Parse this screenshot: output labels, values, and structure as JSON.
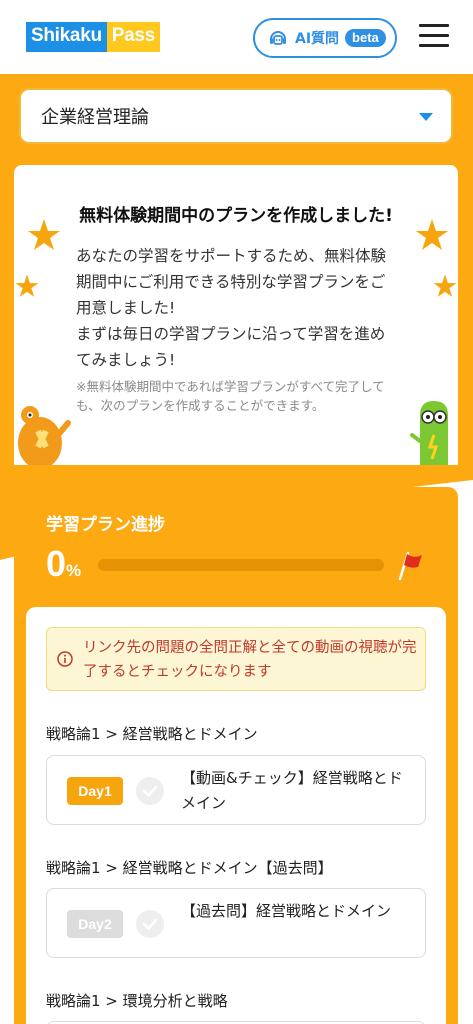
{
  "header": {
    "logo_part1": "Shikaku",
    "logo_part2": "Pass",
    "ai_button_label": "AI質問",
    "ai_badge": "beta",
    "menu_icon": "hamburger-menu-icon"
  },
  "subject_select": {
    "value": "企業経営理論"
  },
  "intro": {
    "title": "無料体験期間中のプランを作成しました!",
    "body": "あなたの学習をサポートするため、無料体験期間中にご利用できる特別な学習プランをご用意しました!\nまずは毎日の学習プランに沿って学習を進めてみましょう!",
    "note": "※無料体験期間中であれば学習プランがすべて完了しても、次のプランを作成することができます。"
  },
  "progress": {
    "title": "学習プラン進捗",
    "percent_value": "0",
    "percent_unit": "%",
    "fraction": 0,
    "notice": "リンク先の問題の全問正解と全ての動画の視聴が完了するとチェックになります"
  },
  "plan": {
    "sections": [
      {
        "label": "戦略論1 > 経営戦略とドメイン",
        "day": "Day1",
        "title": "【動画&チェック】経営戦略とドメイン",
        "active": true
      },
      {
        "label": "戦略論1 > 経営戦略とドメイン【過去問】",
        "day": "Day2",
        "title": "【過去問】経営戦略とドメイン",
        "active": false
      },
      {
        "label": "戦略論1 > 環境分析と戦略"
      }
    ]
  },
  "colors": {
    "brand_orange": "#fca912",
    "brand_blue": "#1c8fe6",
    "logo_yellow": "#ffc81e",
    "notice_red": "#c0392b"
  }
}
